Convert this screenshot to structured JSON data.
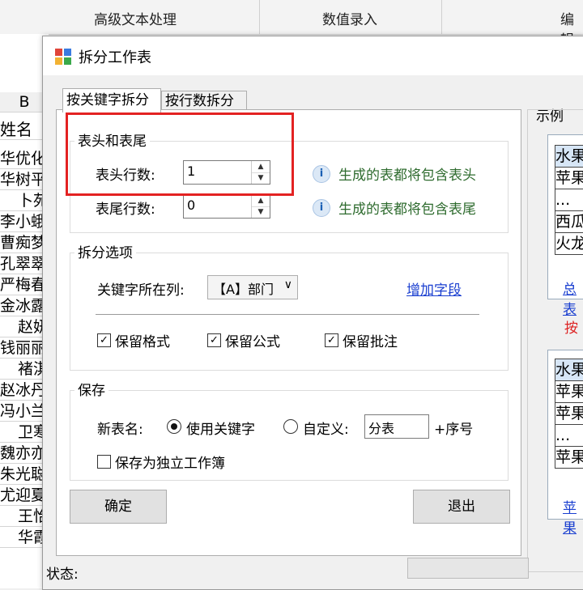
{
  "ribbon": {
    "tabs": [
      "高级文本处理",
      "数值录入",
      "编辑"
    ]
  },
  "sheet": {
    "column_header": "B",
    "rows": [
      "姓名",
      "华优化",
      "华树平",
      "卜苑",
      "李小蛾",
      "曹痴梦",
      "孔翠翠",
      "严梅春",
      "金冰露",
      "赵妍",
      "钱丽丽",
      "褚淇",
      "赵冰丹",
      "冯小兰",
      "卫寒",
      "魏亦亦",
      "朱光聪",
      "尤迎夏",
      "王怡",
      "华霞"
    ]
  },
  "dialog": {
    "title": "拆分工作表",
    "tabs": [
      "按关键字拆分",
      "按行数拆分"
    ],
    "header_footer": {
      "group_label": "表头和表尾",
      "header_rows_label": "表头行数:",
      "header_rows_value": "1",
      "footer_rows_label": "表尾行数:",
      "footer_rows_value": "0",
      "header_hint": "生成的表都将包含表头",
      "footer_hint": "生成的表都将包含表尾"
    },
    "split_options": {
      "group_label": "拆分选项",
      "key_column_label": "关键字所在列:",
      "key_column_value": "【A】部门",
      "add_field_link": "增加字段",
      "keep_format": "保留格式",
      "keep_formula": "保留公式",
      "keep_comment": "保留批注"
    },
    "save": {
      "group_label": "保存",
      "new_name_label": "新表名:",
      "use_keyword": "使用关键字",
      "custom": "自定义:",
      "custom_value": "分表",
      "suffix": "+序号",
      "save_workbook": "保存为独立工作簿"
    },
    "ok_button": "确定",
    "exit_button": "退出",
    "example": {
      "label": "示例",
      "top_cells": [
        "水果",
        "苹果",
        "...",
        "西瓜",
        "火龙"
      ],
      "top_link": "总表",
      "middle_text": "按",
      "bottom_cells": [
        "水果",
        "苹果",
        "苹果",
        "...",
        "苹果"
      ],
      "bottom_link": "苹果"
    },
    "status_label": "状态:"
  },
  "colors": {
    "highlight_border": "#e32222",
    "hint_text": "#2e6b2e",
    "link": "#1a3fd0"
  }
}
